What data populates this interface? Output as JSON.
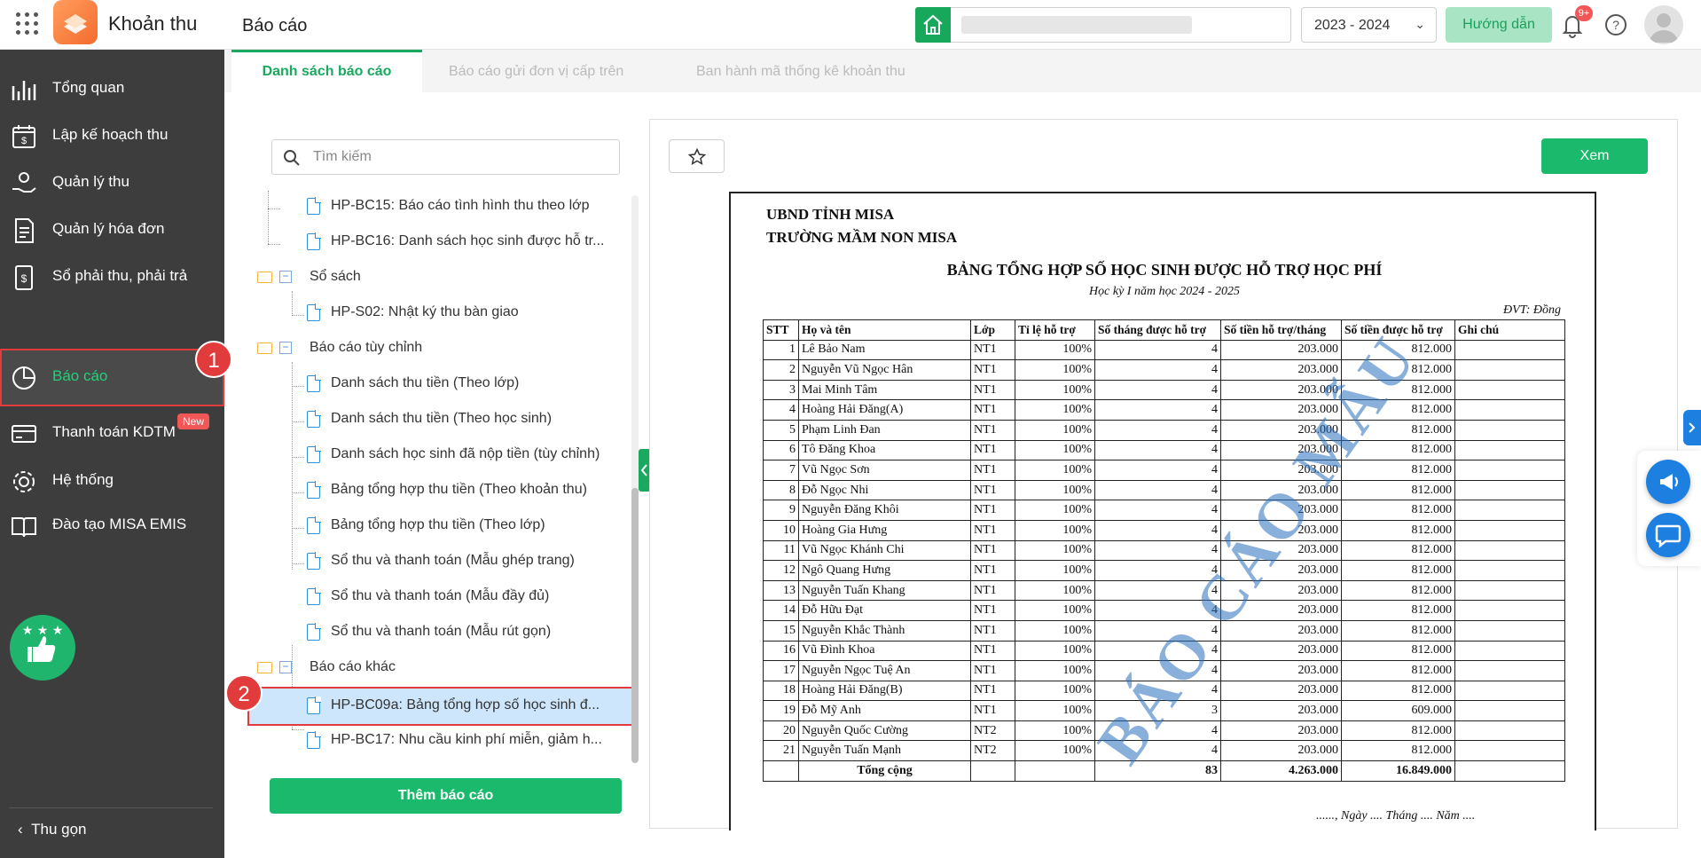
{
  "app": {
    "name": "Khoản thu",
    "page_title": "Báo cáo"
  },
  "header": {
    "year": "2023 - 2024",
    "guide_label": "Hướng dẫn",
    "notif_count": "9+"
  },
  "sidebar": {
    "items": [
      {
        "label": "Tổng quan",
        "icon": "chart-bars-icon"
      },
      {
        "label": "Lập kế hoạch thu",
        "icon": "calendar-money-icon"
      },
      {
        "label": "Quản lý thu",
        "icon": "hand-coin-icon"
      },
      {
        "label": "Quản lý hóa đơn",
        "icon": "invoice-icon"
      },
      {
        "label": "Sổ phải thu, phải trả",
        "icon": "ledger-icon"
      },
      {
        "label": "Báo cáo",
        "icon": "pie-chart-icon"
      },
      {
        "label": "Thanh toán KDTM",
        "icon": "card-icon",
        "badge": "New"
      },
      {
        "label": "Hệ thống",
        "icon": "gear-icon"
      },
      {
        "label": "Đào tạo MISA EMIS",
        "icon": "book-icon"
      }
    ],
    "collapse_label": "Thu gọn"
  },
  "steps": {
    "one": "1",
    "two": "2"
  },
  "tabs": [
    "Danh sách báo cáo",
    "Báo cáo gửi đơn vị cấp trên",
    "Ban hành mã thống kê khoản thu"
  ],
  "tree": {
    "search_placeholder": "Tìm kiếm",
    "items": [
      {
        "type": "doc",
        "label": "HP-BC15: Báo cáo tình hình thu theo lớp"
      },
      {
        "type": "doc",
        "label": "HP-BC16: Danh sách học sinh được hỗ tr..."
      },
      {
        "type": "folder",
        "label": "Sổ sách"
      },
      {
        "type": "doc",
        "label": "HP-S02: Nhật ký thu bàn giao"
      },
      {
        "type": "folder",
        "label": "Báo cáo tùy chỉnh"
      },
      {
        "type": "doc",
        "label": "Danh sách thu tiền (Theo lớp)"
      },
      {
        "type": "doc",
        "label": "Danh sách thu tiền (Theo học sinh)"
      },
      {
        "type": "doc",
        "label": "Danh sách học sinh đã nộp tiền (tùy chỉnh)"
      },
      {
        "type": "doc",
        "label": "Bảng tổng hợp thu tiền (Theo khoản thu)"
      },
      {
        "type": "doc",
        "label": "Bảng tổng hợp thu tiền (Theo lớp)"
      },
      {
        "type": "doc",
        "label": "Sổ thu và thanh toán (Mẫu ghép trang)"
      },
      {
        "type": "doc",
        "label": "Sổ thu và thanh toán (Mẫu đầy đủ)"
      },
      {
        "type": "doc",
        "label": "Sổ thu và thanh toán (Mẫu rút gọn)"
      },
      {
        "type": "folder",
        "label": "Báo cáo khác"
      },
      {
        "type": "doc",
        "label": "HP-BC09a: Bảng tổng hợp số học sinh đ...",
        "selected": true
      },
      {
        "type": "doc",
        "label": "HP-BC17: Nhu cầu kinh phí miễn, giảm h..."
      }
    ],
    "add_label": "Thêm báo cáo"
  },
  "preview": {
    "view_label": "Xem",
    "report": {
      "org1": "UBND TỈNH MISA",
      "org2": "TRƯỜNG MẦM NON MISA",
      "title": "BẢNG TỔNG HỢP SỐ HỌC SINH ĐƯỢC HỖ TRỢ HỌC PHÍ",
      "subtitle": "Học kỳ I năm học 2024 - 2025",
      "unit": "ĐVT: Đồng",
      "watermark": "BÁO CÁO MẪU",
      "columns": [
        "STT",
        "Họ và tên",
        "Lớp",
        "Tỉ lệ hỗ trợ",
        "Số tháng được hỗ trợ",
        "Số tiền hỗ trợ/tháng",
        "Số tiền được hỗ trợ",
        "Ghi chú"
      ],
      "rows": [
        [
          "1",
          "Lê Bảo Nam",
          "NT1",
          "100%",
          "4",
          "203.000",
          "812.000",
          ""
        ],
        [
          "2",
          "Nguyễn Vũ Ngọc Hân",
          "NT1",
          "100%",
          "4",
          "203.000",
          "812.000",
          ""
        ],
        [
          "3",
          "Mai Minh Tâm",
          "NT1",
          "100%",
          "4",
          "203.000",
          "812.000",
          ""
        ],
        [
          "4",
          "Hoàng Hải Đăng(A)",
          "NT1",
          "100%",
          "4",
          "203.000",
          "812.000",
          ""
        ],
        [
          "5",
          "Phạm Linh Đan",
          "NT1",
          "100%",
          "4",
          "203.000",
          "812.000",
          ""
        ],
        [
          "6",
          "Tô Đăng Khoa",
          "NT1",
          "100%",
          "4",
          "203.000",
          "812.000",
          ""
        ],
        [
          "7",
          "Vũ Ngọc Sơn",
          "NT1",
          "100%",
          "4",
          "203.000",
          "812.000",
          ""
        ],
        [
          "8",
          "Đỗ Ngọc Nhi",
          "NT1",
          "100%",
          "4",
          "203.000",
          "812.000",
          ""
        ],
        [
          "9",
          "Nguyễn Đăng Khôi",
          "NT1",
          "100%",
          "4",
          "203.000",
          "812.000",
          ""
        ],
        [
          "10",
          "Hoàng Gia Hưng",
          "NT1",
          "100%",
          "4",
          "203.000",
          "812.000",
          ""
        ],
        [
          "11",
          "Vũ Ngọc Khánh Chi",
          "NT1",
          "100%",
          "4",
          "203.000",
          "812.000",
          ""
        ],
        [
          "12",
          "Ngô Quang Hưng",
          "NT1",
          "100%",
          "4",
          "203.000",
          "812.000",
          ""
        ],
        [
          "13",
          "Nguyễn Tuấn Khang",
          "NT1",
          "100%",
          "4",
          "203.000",
          "812.000",
          ""
        ],
        [
          "14",
          "Đỗ Hữu Đạt",
          "NT1",
          "100%",
          "4",
          "203.000",
          "812.000",
          ""
        ],
        [
          "15",
          "Nguyễn Khắc Thành",
          "NT1",
          "100%",
          "4",
          "203.000",
          "812.000",
          ""
        ],
        [
          "16",
          "Vũ Đình Khoa",
          "NT1",
          "100%",
          "4",
          "203.000",
          "812.000",
          ""
        ],
        [
          "17",
          "Nguyễn Ngọc Tuệ An",
          "NT1",
          "100%",
          "4",
          "203.000",
          "812.000",
          ""
        ],
        [
          "18",
          "Hoàng Hải Đăng(B)",
          "NT1",
          "100%",
          "4",
          "203.000",
          "812.000",
          ""
        ],
        [
          "19",
          "Đỗ Mỹ Anh",
          "NT1",
          "100%",
          "3",
          "203.000",
          "609.000",
          ""
        ],
        [
          "20",
          "Nguyễn Quốc Cường",
          "NT2",
          "100%",
          "4",
          "203.000",
          "812.000",
          ""
        ],
        [
          "21",
          "Nguyễn Tuấn Mạnh",
          "NT2",
          "100%",
          "4",
          "203.000",
          "812.000",
          ""
        ]
      ],
      "total": {
        "label": "Tổng cộng",
        "months": "83",
        "per_month": "4.263.000",
        "amount": "16.849.000"
      },
      "date_line": "......, Ngày .... Tháng .... Năm ...."
    }
  },
  "colors": {
    "accent": "#1aa95f",
    "sidebar": "#3d3d3d",
    "highlight": "#e23b3b",
    "watermark": "#2d6eb8"
  }
}
